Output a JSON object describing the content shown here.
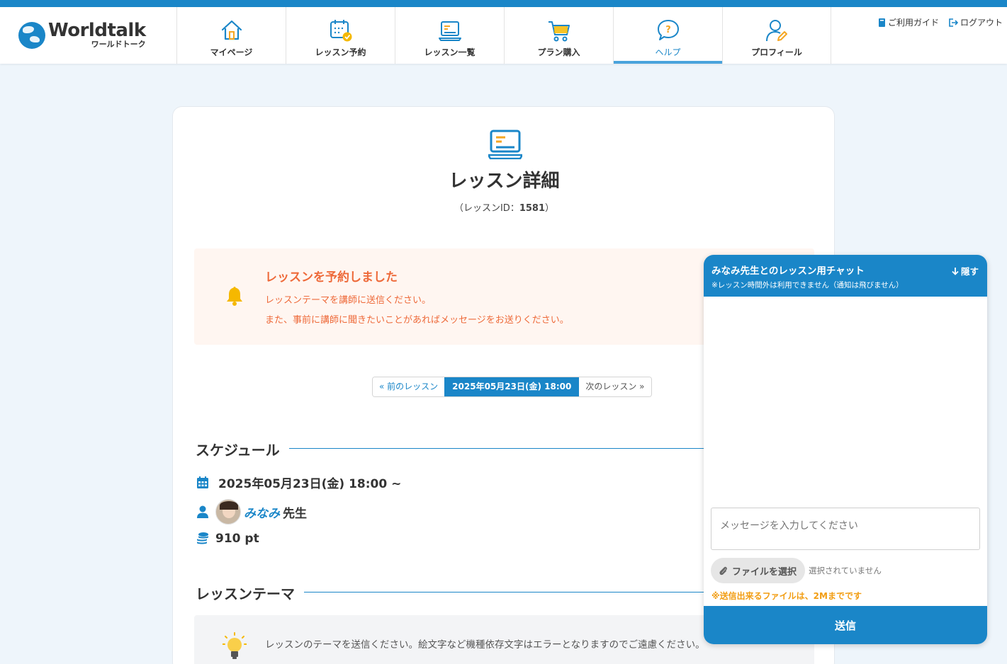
{
  "header": {
    "logo_main": "Worldtalk",
    "logo_sub": "ワールドトーク",
    "nav": [
      {
        "label": "マイページ",
        "icon": "home-icon"
      },
      {
        "label": "レッスン予約",
        "icon": "calendar-check-icon"
      },
      {
        "label": "レッスン一覧",
        "icon": "laptop-icon"
      },
      {
        "label": "プラン購入",
        "icon": "cart-icon"
      },
      {
        "label": "ヘルプ",
        "icon": "help-icon",
        "active": true
      },
      {
        "label": "プロフィール",
        "icon": "profile-edit-icon"
      }
    ],
    "links": {
      "guide": "ご利用ガイド",
      "logout": "ログアウト"
    }
  },
  "page": {
    "title": "レッスン詳細",
    "lesson_id_prefix": "（レッスンID：",
    "lesson_id": "1581",
    "lesson_id_suffix": "）"
  },
  "notice": {
    "title": "レッスンを予約しました",
    "line1": "レッスンテーマを講師に送信ください。",
    "line2": "また、事前に講師に聞きたいことがあればメッセージをお送りください。"
  },
  "pager": {
    "prev": "« 前のレッスン",
    "current": "2025年05月23日(金) 18:00",
    "next": "次のレッスン »"
  },
  "schedule": {
    "heading": "スケジュール",
    "datetime": "2025年05月23日(金) 18:00 ~",
    "teacher_name": "みなみ",
    "teacher_suffix": "先生",
    "points": "910 pt"
  },
  "theme": {
    "heading": "レッスンテーマ",
    "text": "レッスンのテーマを送信ください。絵文字など機種依存文字はエラーとなりますのでご遠慮ください。"
  },
  "chat": {
    "title": "みなみ先生とのレッスン用チャット",
    "subtitle": "※レッスン時間外は利用できません（通知は飛びません）",
    "hide": "隠す",
    "input_placeholder": "メッセージを入力してください",
    "file_button": "ファイルを選択",
    "file_status": "選択されていません",
    "file_note": "※送信出来るファイルは、2Mまでです",
    "send": "送信"
  },
  "colors": {
    "primary": "#1a86c8",
    "accent_orange": "#ee6a3a",
    "bell_yellow": "#f5b800",
    "note_orange": "#f29d12"
  }
}
